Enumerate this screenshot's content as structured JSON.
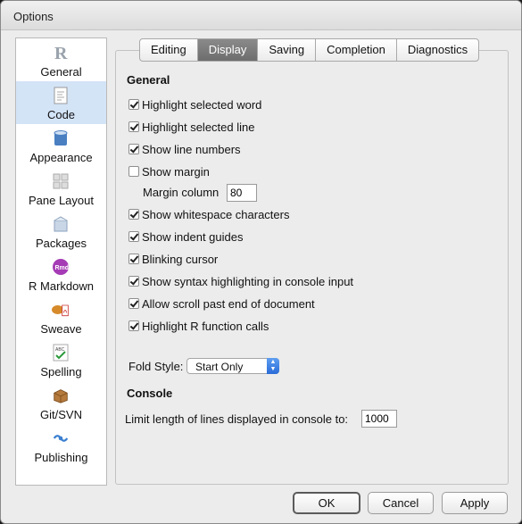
{
  "window": {
    "title": "Options"
  },
  "sidebar": {
    "items": [
      {
        "label": "General",
        "icon": "r-logo-icon",
        "selected": false
      },
      {
        "label": "Code",
        "icon": "code-document-icon",
        "selected": true
      },
      {
        "label": "Appearance",
        "icon": "paint-bucket-icon",
        "selected": false
      },
      {
        "label": "Pane Layout",
        "icon": "pane-layout-icon",
        "selected": false
      },
      {
        "label": "Packages",
        "icon": "package-box-icon",
        "selected": false
      },
      {
        "label": "R Markdown",
        "icon": "rmd-icon",
        "selected": false
      },
      {
        "label": "Sweave",
        "icon": "sweave-pdf-icon",
        "selected": false
      },
      {
        "label": "Spelling",
        "icon": "spellcheck-icon",
        "selected": false
      },
      {
        "label": "Git/SVN",
        "icon": "git-box-icon",
        "selected": false
      },
      {
        "label": "Publishing",
        "icon": "publishing-icon",
        "selected": false
      }
    ]
  },
  "tabs": [
    {
      "label": "Editing",
      "active": false
    },
    {
      "label": "Display",
      "active": true
    },
    {
      "label": "Saving",
      "active": false
    },
    {
      "label": "Completion",
      "active": false
    },
    {
      "label": "Diagnostics",
      "active": false
    }
  ],
  "general": {
    "title": "General",
    "options": [
      {
        "label": "Highlight selected word",
        "checked": true
      },
      {
        "label": "Highlight selected line",
        "checked": true
      },
      {
        "label": "Show line numbers",
        "checked": true
      },
      {
        "label": "Show margin",
        "checked": false
      },
      {
        "label": "Show whitespace characters",
        "checked": true
      },
      {
        "label": "Show indent guides",
        "checked": true
      },
      {
        "label": "Blinking cursor",
        "checked": true
      },
      {
        "label": "Show syntax highlighting in console input",
        "checked": true
      },
      {
        "label": "Allow scroll past end of document",
        "checked": true
      },
      {
        "label": "Highlight R function calls",
        "checked": true
      }
    ],
    "margin_column_label": "Margin column",
    "margin_column_value": "80",
    "fold_style_label": "Fold Style:",
    "fold_style_value": "Start Only"
  },
  "console": {
    "title": "Console",
    "limit_label": "Limit length of lines displayed in console to:",
    "limit_value": "1000"
  },
  "buttons": {
    "ok": "OK",
    "cancel": "Cancel",
    "apply": "Apply"
  },
  "colors": {
    "selected_sidebar": "#d4e4f7",
    "active_tab": "#7a7a7a",
    "select_accent": "#2a6bd8"
  }
}
